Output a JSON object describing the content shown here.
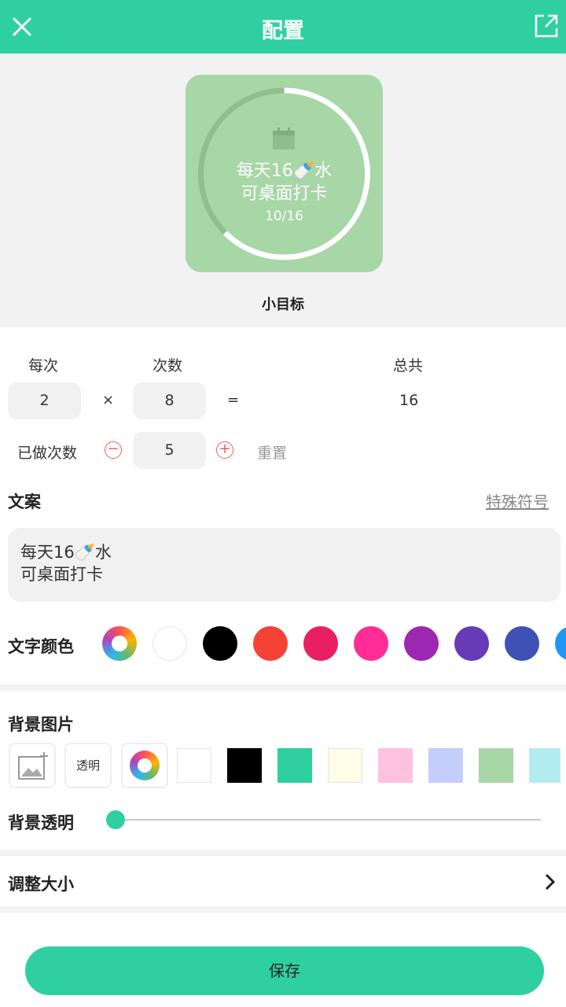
{
  "header": {
    "title": "配置",
    "close_icon": "close-icon",
    "share_icon": "share-icon"
  },
  "preview": {
    "line1": "每天16🍼水",
    "line2": "可桌面打卡",
    "progress_text": "10/16",
    "progress_fraction": 0.625,
    "name": "小目标",
    "calendar_icon": "calendar-icon"
  },
  "counter": {
    "per_time_label": "每次",
    "times_label": "次数",
    "total_label": "总共",
    "per_time_value": "2",
    "multiply": "×",
    "times_value": "8",
    "equals": "=",
    "total_value": "16",
    "done_label": "已做次数",
    "done_value": "5",
    "reset_label": "重置"
  },
  "copy": {
    "title": "文案",
    "special_symbols": "特殊符号",
    "text": "每天16🍼水\n可桌面打卡"
  },
  "text_color": {
    "label": "文字颜色",
    "colors": [
      "#ffffff",
      "#000000",
      "#f44336",
      "#e91e63",
      "#ff2d95",
      "#9c27b0",
      "#673ab7",
      "#3f51b5",
      "#2196f3"
    ]
  },
  "background": {
    "title": "背景图片",
    "transparent_label": "透明",
    "colors": [
      "#ffffff",
      "#000000",
      "#2fd0a0",
      "#fefee8",
      "#ffc1e0",
      "#c5cdfb",
      "#a7d6a7",
      "#b3ecf0"
    ],
    "opacity_label": "背景透明",
    "opacity_value": 0
  },
  "resize": {
    "label": "调整大小"
  },
  "save": {
    "label": "保存"
  }
}
